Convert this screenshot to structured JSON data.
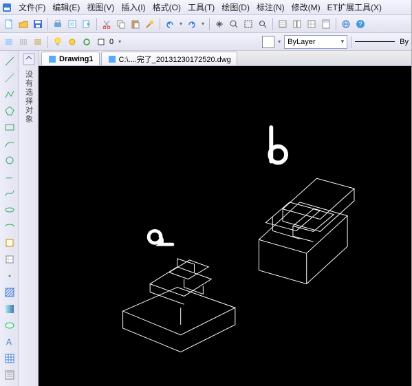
{
  "menu": {
    "items": [
      {
        "label": "文件(F)"
      },
      {
        "label": "编辑(E)"
      },
      {
        "label": "视图(V)"
      },
      {
        "label": "插入(I)"
      },
      {
        "label": "格式(O)"
      },
      {
        "label": "工具(T)"
      },
      {
        "label": "绘图(D)"
      },
      {
        "label": "标注(N)"
      },
      {
        "label": "修改(M)"
      },
      {
        "label": "ET扩展工具(X)"
      }
    ]
  },
  "toolbar1": {
    "icons": [
      "new-icon",
      "open-icon",
      "save-icon",
      "sep",
      "print-icon",
      "preview-icon",
      "export-icon",
      "sep",
      "cut-icon",
      "copy-icon",
      "paste-icon",
      "erase-icon",
      "sep",
      "undo-icon",
      "dd",
      "redo-icon",
      "dd",
      "sep",
      "pan-icon",
      "zoom-in-icon",
      "zoom-window-icon",
      "zoom-extents-icon",
      "sep",
      "table-icon",
      "props-icon",
      "grid-icon",
      "sheet-icon",
      "sep",
      "globe-icon",
      "help-icon"
    ]
  },
  "toolbar2": {
    "groupA": [
      "layer-iso-icon",
      "layer-unhide-icon",
      "layer-walk-icon"
    ],
    "groupB": [
      "bulb-icon",
      "sun-icon",
      "lock-icon",
      "color-icon"
    ],
    "zero": "0",
    "layer_value": "ByLayer",
    "bylabel": "By"
  },
  "sidepanel": {
    "label": "没有选择对象"
  },
  "tabs": [
    {
      "icon": "dwg-icon",
      "label": "Drawing1",
      "active": true
    },
    {
      "icon": "dwg-icon",
      "label": "C:\\....完了_20131230172520.dwg",
      "active": false
    }
  ],
  "canvas": {
    "annotations": [
      {
        "text": "a"
      },
      {
        "text": "b"
      }
    ]
  }
}
